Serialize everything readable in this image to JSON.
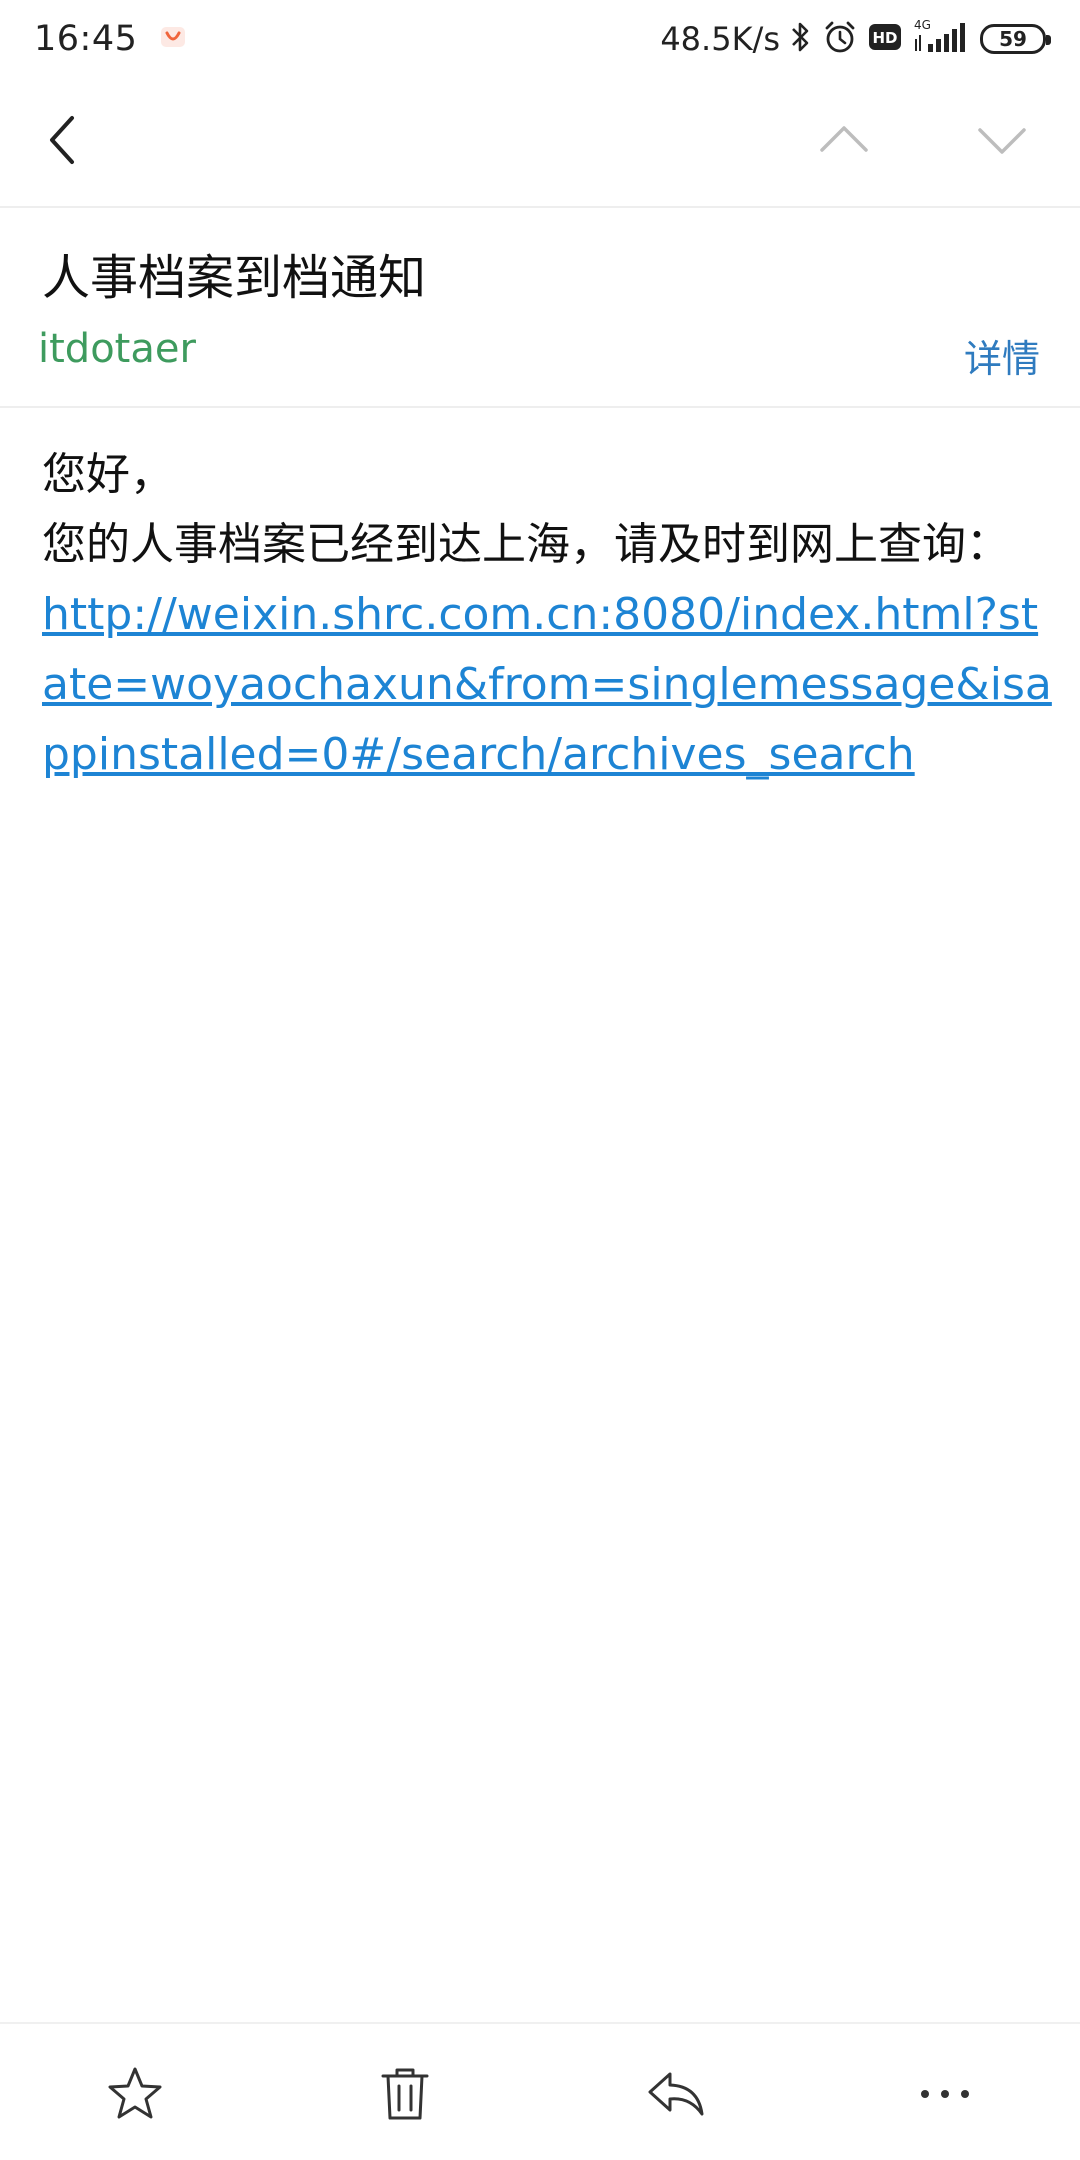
{
  "status_bar": {
    "time": "16:45",
    "network_speed": "48.5K/s",
    "network_type": "4G",
    "hd_label": "HD",
    "battery": "59",
    "icons": [
      "app-notification-icon",
      "bluetooth-icon",
      "alarm-icon",
      "hd-icon",
      "signal-icon",
      "battery-icon"
    ]
  },
  "nav": {
    "icons": [
      "back-arrow-icon",
      "previous-mail-icon",
      "next-mail-icon"
    ]
  },
  "mail": {
    "subject": "人事档案到档通知",
    "sender": "itdotaer",
    "details_label": "详情",
    "greeting": "您好，",
    "message": "您的人事档案已经到达上海，请及时到网上查询：",
    "link": "http://weixin.shrc.com.cn:8080/index.html?state=woyaochaxun&from=singlemessage&isappinstalled=0#/search/archives_search"
  },
  "toolbar": {
    "icons": [
      "star-icon",
      "trash-icon",
      "reply-icon",
      "more-icon"
    ]
  },
  "colors": {
    "sender": "#3e9b5e",
    "details": "#2f7bbf",
    "link": "#1d84d4",
    "icon_gray": "#bdbdbd",
    "icon_dark": "#333333"
  }
}
